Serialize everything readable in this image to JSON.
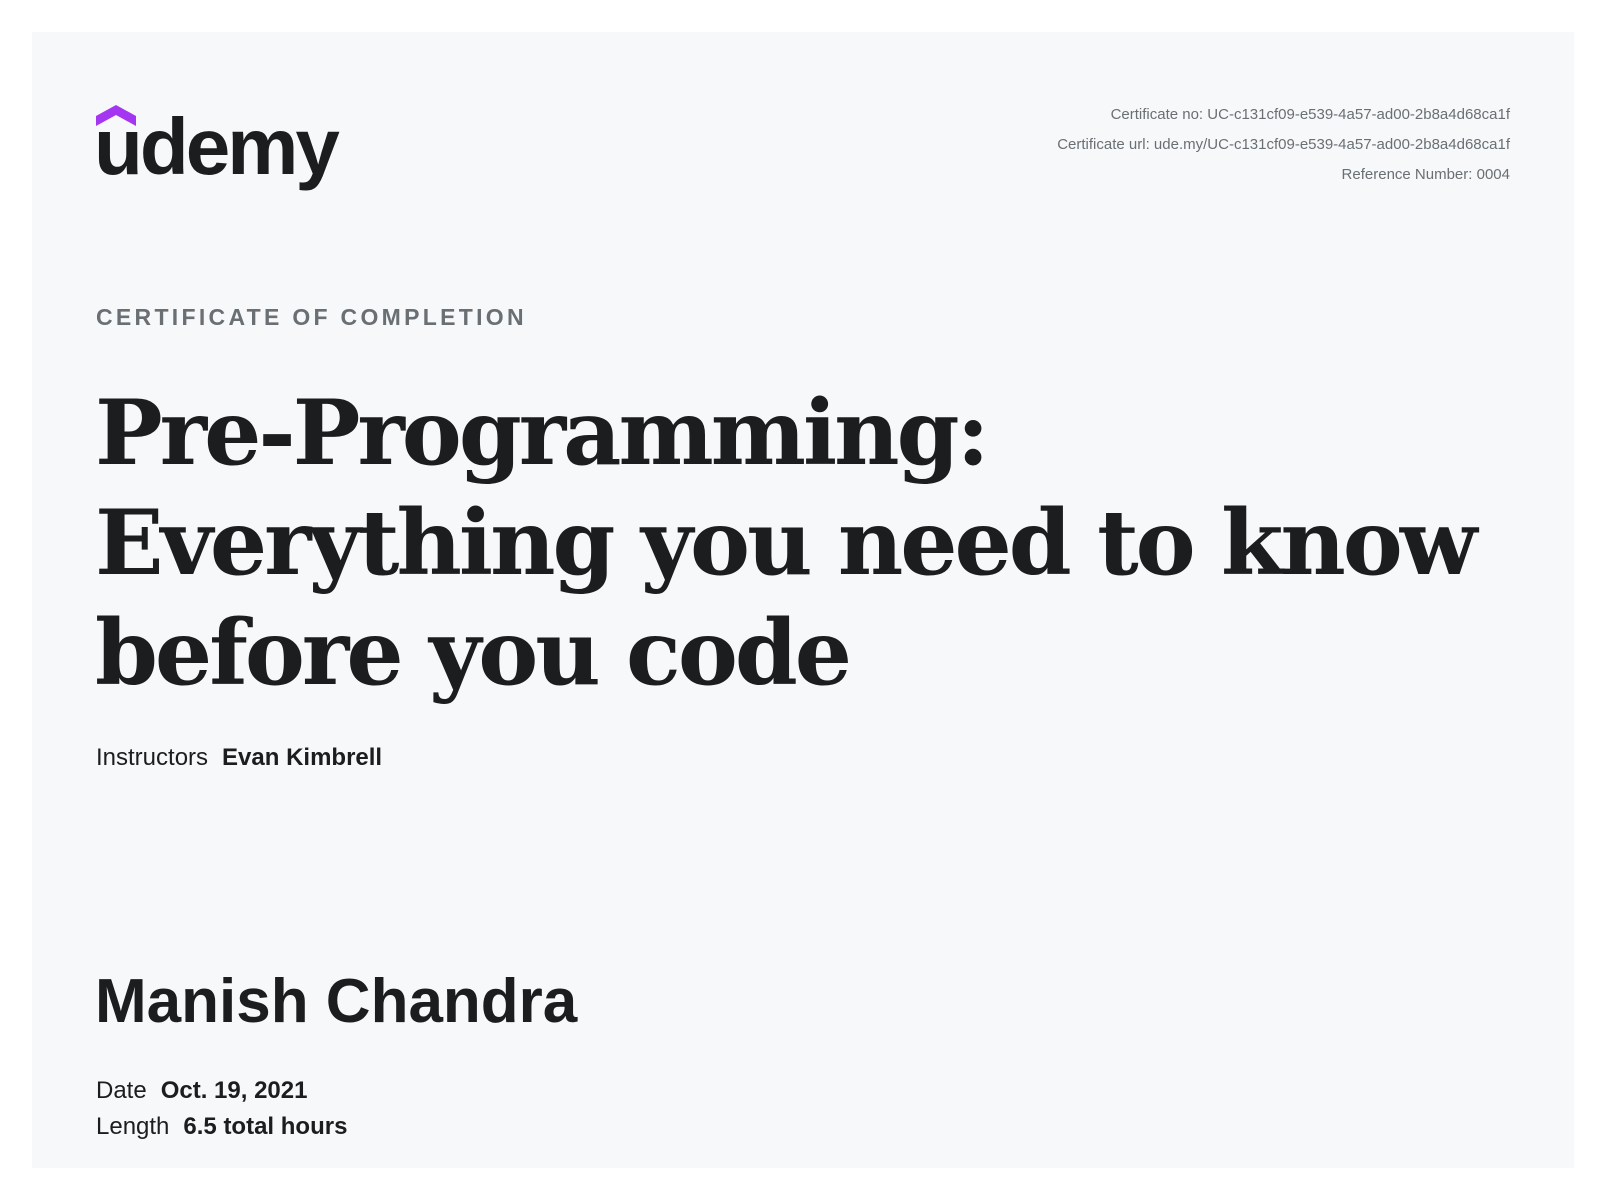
{
  "brand": {
    "logo_text": "udemy",
    "logo_icon": "udemy-roof-mark",
    "accent_color": "#a435f0",
    "text_color": "#1c1d1f"
  },
  "meta": {
    "certificate_no_label": "Certificate no:",
    "certificate_no": "UC-c131cf09-e539-4a57-ad00-2b8a4d68ca1f",
    "certificate_url_label": "Certificate url:",
    "certificate_url": "ude.my/UC-c131cf09-e539-4a57-ad00-2b8a4d68ca1f",
    "reference_label": "Reference Number:",
    "reference_number": "0004"
  },
  "certificate": {
    "eyebrow": "CERTIFICATE OF COMPLETION",
    "course_title": "Pre-Programming: Everything you need to know before you code",
    "instructors_label": "Instructors",
    "instructors": "Evan Kimbrell",
    "student_name": "Manish Chandra",
    "date_label": "Date",
    "date": "Oct. 19, 2021",
    "length_label": "Length",
    "length": "6.5 total hours"
  }
}
